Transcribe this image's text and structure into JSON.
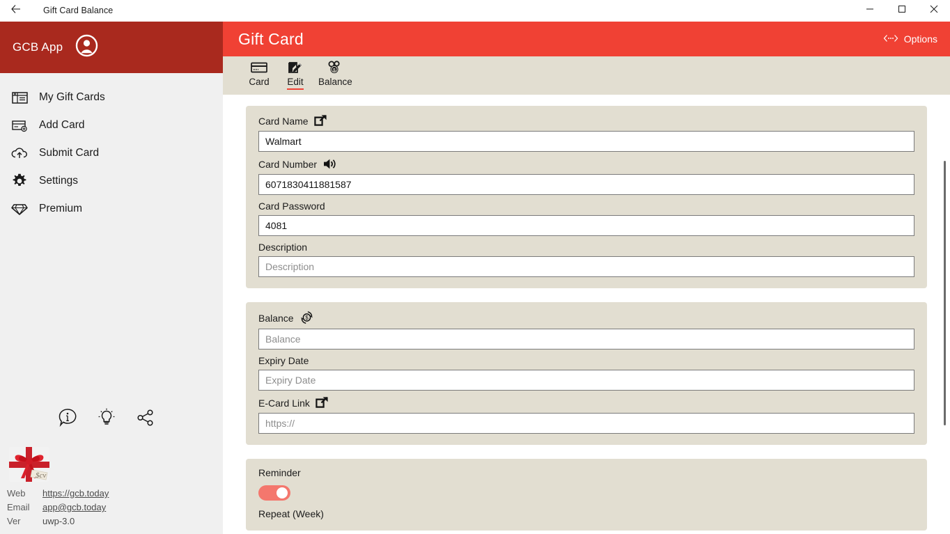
{
  "titlebar": {
    "back_icon": "arrow-left-icon",
    "title": "Gift Card Balance",
    "minimize": "─",
    "maximize": "□",
    "close": "✕"
  },
  "sidebar": {
    "app_name": "GCB App",
    "avatar_icon": "account-circle-icon",
    "items": [
      {
        "label": "My Gift Cards",
        "icon": "gift-card-icon"
      },
      {
        "label": "Add Card",
        "icon": "add-card-icon"
      },
      {
        "label": "Submit Card",
        "icon": "cloud-upload-icon"
      },
      {
        "label": "Settings",
        "icon": "gear-icon"
      },
      {
        "label": "Premium",
        "icon": "diamond-icon"
      }
    ],
    "utility_icons": [
      {
        "name": "info-bubble-icon"
      },
      {
        "name": "lightbulb-icon"
      },
      {
        "name": "share-icon"
      }
    ],
    "brand_image": "gift-box-with-red-ribbon",
    "meta": [
      {
        "key": "Web",
        "value": "https://gcb.today",
        "link": true
      },
      {
        "key": "Email",
        "value": "app@gcb.today",
        "link": true
      },
      {
        "key": "Ver",
        "value": "uwp-3.0",
        "link": false
      }
    ]
  },
  "main": {
    "header": {
      "title": "Gift Card",
      "options_label": "Options",
      "options_icon": "more-horizontal-icon"
    },
    "tabs": [
      {
        "label": "Card",
        "icon": "credit-card-icon",
        "active": false
      },
      {
        "label": "Edit",
        "icon": "edit-pencil-icon",
        "active": true
      },
      {
        "label": "Balance",
        "icon": "coins-dollar-icon",
        "active": false
      }
    ],
    "panels": [
      {
        "name": "card-details",
        "fields": [
          {
            "label": "Card Name",
            "icon": "external-link-icon",
            "value": "Walmart",
            "placeholder": "Card Name"
          },
          {
            "label": "Card Number",
            "icon": "speaker-icon",
            "value": "6071830411881587",
            "placeholder": "Card Number"
          },
          {
            "label": "Card Password",
            "icon": null,
            "value": "4081",
            "placeholder": "Card Password"
          },
          {
            "label": "Description",
            "icon": null,
            "value": "",
            "placeholder": "Description"
          }
        ]
      },
      {
        "name": "balance-details",
        "fields": [
          {
            "label": "Balance",
            "icon": "refresh-dollar-icon",
            "value": "",
            "placeholder": "Balance"
          },
          {
            "label": "Expiry Date",
            "icon": null,
            "value": "",
            "placeholder": "Expiry Date"
          },
          {
            "label": "E-Card Link",
            "icon": "external-link-icon",
            "value": "",
            "placeholder": "https://"
          }
        ]
      }
    ],
    "reminder": {
      "label": "Reminder",
      "toggle_on": true,
      "repeat_label": "Repeat (Week)"
    }
  },
  "colors": {
    "sidebar_red": "#a9291e",
    "header_red": "#f04134",
    "panel_beige": "#e2ded1",
    "toggle_on": "#f4776d",
    "sidebar_bg": "#f0f0f0"
  }
}
